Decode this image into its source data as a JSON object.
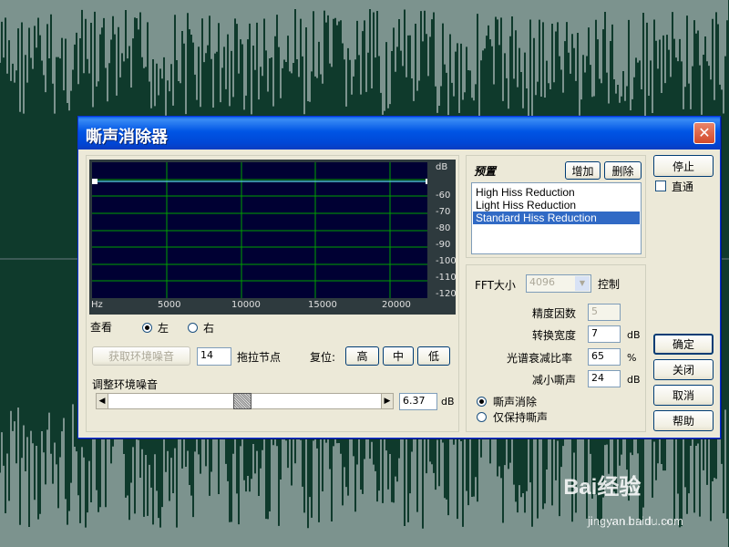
{
  "dialog": {
    "title": "嘶声消除器",
    "close_glyph": "✕"
  },
  "graph": {
    "db_labels": [
      "dB",
      "-60",
      "-70",
      "-80",
      "-90",
      "-100",
      "-110",
      "-120"
    ],
    "hz_labels": [
      "Hz",
      "5000",
      "10000",
      "15000",
      "20000"
    ],
    "curve_color": "#4ab8c8",
    "grid_color": "#00a000"
  },
  "view": {
    "label": "查看",
    "left": "左",
    "right": "右",
    "selected": "左"
  },
  "noise_row": {
    "get_noise_button": "获取环境噪音",
    "nodes_value": "14",
    "nodes_label": "拖拉节点",
    "reset_label": "复位:",
    "high": "高",
    "mid": "中",
    "low": "低"
  },
  "adjust": {
    "label": "调整环境噪音",
    "value": "6.37",
    "unit": "dB",
    "level_fraction": 0.49
  },
  "presets": {
    "label": "预置",
    "add_button": "增加",
    "delete_button": "删除",
    "items": [
      "High Hiss Reduction",
      "Light Hiss Reduction",
      "Standard Hiss Reduction"
    ],
    "selected_index": 2
  },
  "settings": {
    "fft_label": "FFT大小",
    "fft_value": "4096",
    "control_button": "控制",
    "precision_label": "精度因数",
    "precision_value": "5",
    "transition_label": "转换宽度",
    "transition_value": "7",
    "transition_unit": "dB",
    "decay_label": "光谱衰减比率",
    "decay_value": "65",
    "decay_unit": "%",
    "reduce_label": "减小嘶声",
    "reduce_value": "24",
    "reduce_unit": "dB",
    "mode_remove": "嘶声消除",
    "mode_keep": "仅保持嘶声",
    "selected_mode": "嘶声消除"
  },
  "side": {
    "stop": "停止",
    "bypass": "直通",
    "ok": "确定",
    "close": "关闭",
    "cancel": "取消",
    "help": "帮助"
  },
  "watermark": {
    "brand": "Bai经验",
    "url": "jingyan.baidu.com"
  }
}
